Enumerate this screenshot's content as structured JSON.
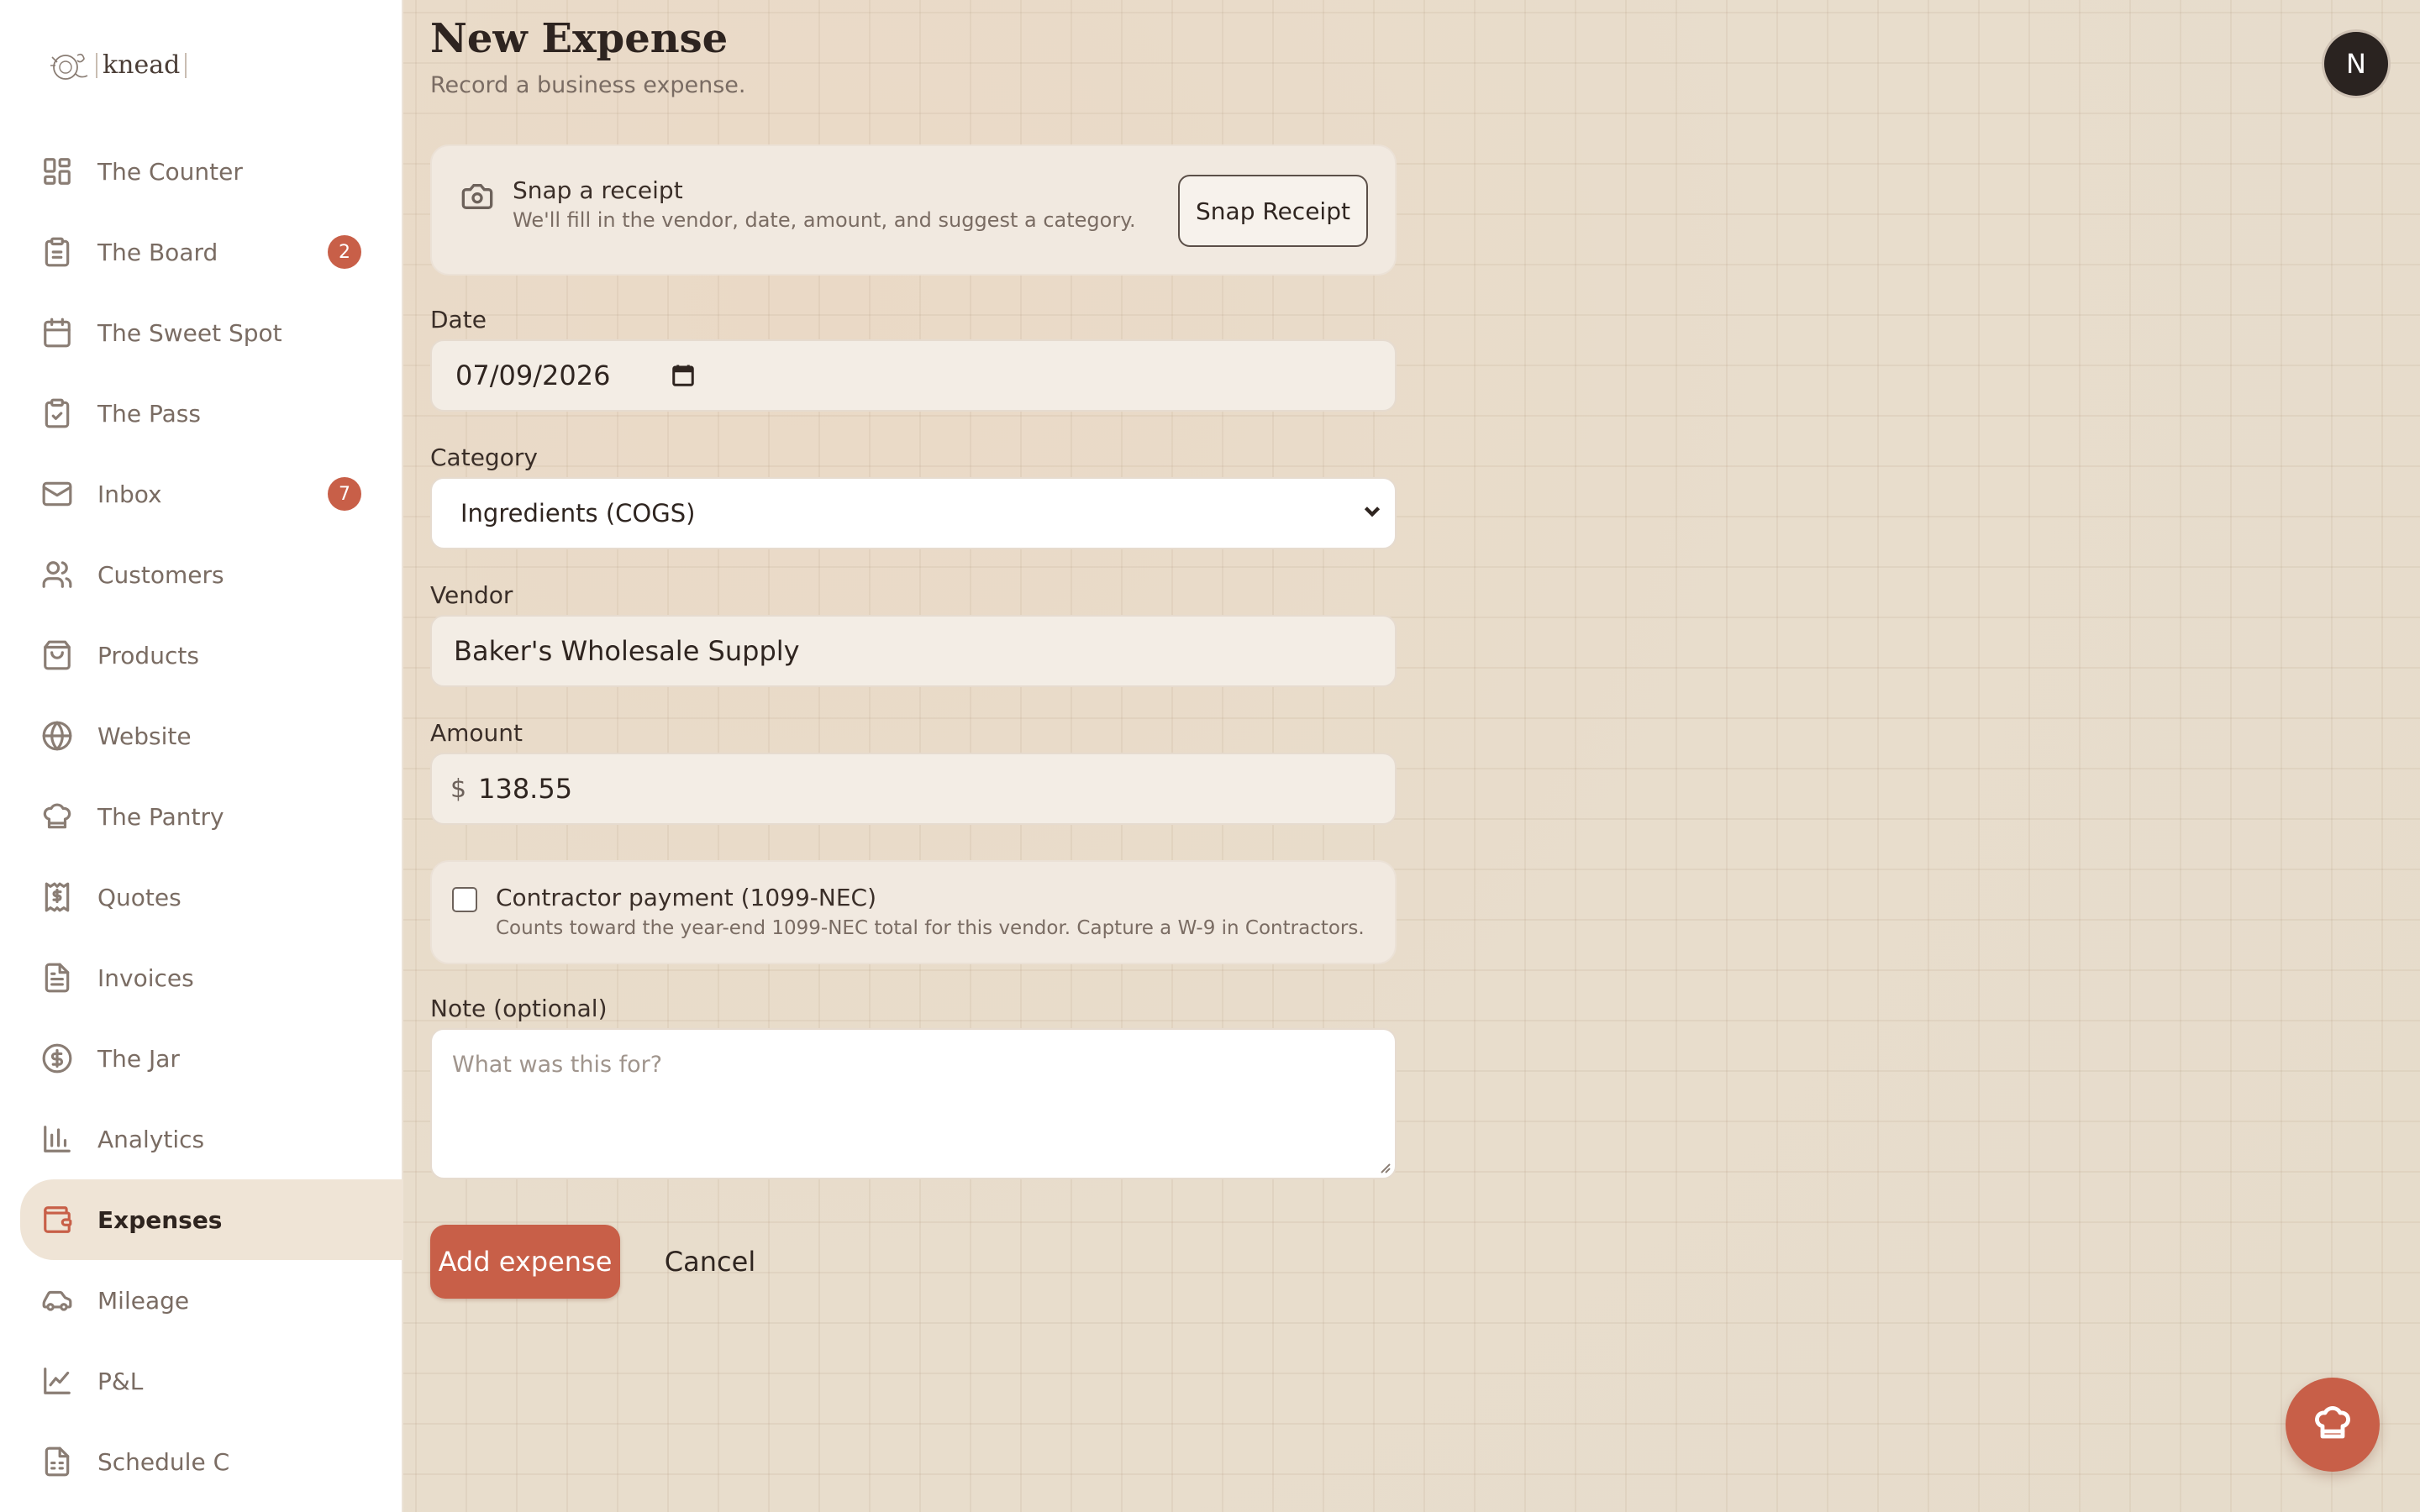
{
  "app": {
    "logo_text": "knead",
    "avatar_initial": "N"
  },
  "sidebar": {
    "items": [
      {
        "label": "The Counter",
        "icon": "dashboard-grid-icon"
      },
      {
        "label": "The Board",
        "icon": "clipboard-icon",
        "badge": "2"
      },
      {
        "label": "The Sweet Spot",
        "icon": "calendar-icon"
      },
      {
        "label": "The Pass",
        "icon": "clipboard-check-icon"
      },
      {
        "label": "Inbox",
        "icon": "mail-icon",
        "badge": "7"
      },
      {
        "label": "Customers",
        "icon": "users-icon"
      },
      {
        "label": "Products",
        "icon": "shopping-bag-icon"
      },
      {
        "label": "Website",
        "icon": "globe-icon"
      },
      {
        "label": "The Pantry",
        "icon": "chef-hat-icon"
      },
      {
        "label": "Quotes",
        "icon": "receipt-dollar-icon"
      },
      {
        "label": "Invoices",
        "icon": "file-text-icon"
      },
      {
        "label": "The Jar",
        "icon": "dollar-circle-icon"
      },
      {
        "label": "Analytics",
        "icon": "bar-chart-icon"
      },
      {
        "label": "Expenses",
        "icon": "wallet-icon",
        "active": true
      },
      {
        "label": "Mileage",
        "icon": "car-icon"
      },
      {
        "label": "P&L",
        "icon": "line-chart-icon"
      },
      {
        "label": "Schedule C",
        "icon": "file-spreadsheet-icon"
      }
    ]
  },
  "main": {
    "title": "New Expense",
    "subtitle": "Record a business expense.",
    "receipt": {
      "title": "Snap a receipt",
      "description": "We'll fill in the vendor, date, amount, and suggest a category.",
      "button_label": "Snap Receipt"
    },
    "date": {
      "label": "Date",
      "value": "07/09/2026"
    },
    "category": {
      "label": "Category",
      "value": "Ingredients (COGS)"
    },
    "vendor": {
      "label": "Vendor",
      "value": "Baker's Wholesale Supply"
    },
    "amount": {
      "label": "Amount",
      "currency": "$",
      "value": "138.55"
    },
    "contractor": {
      "label": "Contractor payment (1099-NEC)",
      "description": "Counts toward the year-end 1099-NEC total for this vendor. Capture a W-9 in Contractors.",
      "checked": false
    },
    "note": {
      "label": "Note (optional)",
      "placeholder": "What was this for?"
    },
    "actions": {
      "submit_label": "Add expense",
      "cancel_label": "Cancel"
    }
  },
  "colors": {
    "accent": "#c85f48",
    "sidebar_bg": "#ffffff",
    "main_bg": "#e9dccb"
  }
}
